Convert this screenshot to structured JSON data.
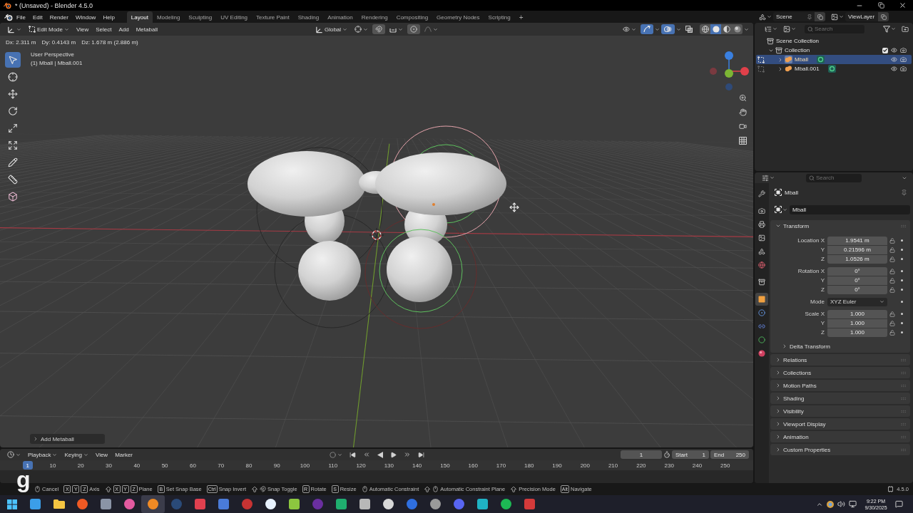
{
  "window": {
    "title": "* (Unsaved) - Blender 4.5.0"
  },
  "menu": [
    "File",
    "Edit",
    "Render",
    "Window",
    "Help"
  ],
  "workspaces": [
    {
      "label": "Layout",
      "selected": true
    },
    {
      "label": "Modeling",
      "selected": false
    },
    {
      "label": "Sculpting",
      "selected": false
    },
    {
      "label": "UV Editing",
      "selected": false
    },
    {
      "label": "Texture Paint",
      "selected": false
    },
    {
      "label": "Shading",
      "selected": false
    },
    {
      "label": "Animation",
      "selected": false
    },
    {
      "label": "Rendering",
      "selected": false
    },
    {
      "label": "Compositing",
      "selected": false
    },
    {
      "label": "Geometry Nodes",
      "selected": false
    },
    {
      "label": "Scripting",
      "selected": false
    }
  ],
  "add_workspace": "+",
  "scene": "Scene",
  "view_layer": "ViewLayer",
  "viewport": {
    "mode": "Edit Mode",
    "menus": [
      "View",
      "Select",
      "Add",
      "Metaball"
    ],
    "orientation": "Global",
    "gizmos": true,
    "overlays": true,
    "xray": false,
    "shading": [
      {
        "kind": "wireframe",
        "selected": false
      },
      {
        "kind": "solid",
        "selected": true
      },
      {
        "kind": "material",
        "selected": false
      },
      {
        "kind": "rendered",
        "selected": false
      }
    ],
    "readout": [
      "Dx: 2.311 m",
      "Dy: 0.4143 m",
      "Dz: 1.678 m (2.886 m)"
    ],
    "view_name": "User Perspective",
    "object_info": "(1) Mball | Mball.001",
    "tools": [
      {
        "kind": "select",
        "selected": true
      },
      {
        "kind": "cursor",
        "selected": false
      },
      {
        "kind": "move",
        "selected": false
      },
      {
        "kind": "rotate",
        "selected": false
      },
      {
        "kind": "scale",
        "selected": false
      },
      {
        "kind": "transform",
        "selected": false
      },
      {
        "kind": "annotate",
        "selected": false
      },
      {
        "kind": "measure",
        "selected": false
      },
      {
        "kind": "add",
        "selected": false
      }
    ],
    "last_operator": {
      "label": "Add Metaball",
      "expanded": false
    }
  },
  "key_overlay": "g",
  "outliner": {
    "search_placeholder": "Search",
    "tree": [
      {
        "kind": "scene_collection",
        "label": "Scene Collection",
        "selected": false,
        "children": [
          {
            "kind": "collection",
            "label": "Collection",
            "selected": false,
            "expanded": true,
            "checked": true,
            "visible": true,
            "renderable": true,
            "children": [
              {
                "kind": "metaball",
                "label": "Mball",
                "selected": true,
                "expanded": false,
                "visible": true,
                "renderable": true
              },
              {
                "kind": "metaball",
                "label": "Mball.001",
                "selected": false,
                "expanded": false,
                "visible": true,
                "renderable": true
              }
            ]
          }
        ]
      }
    ]
  },
  "properties": {
    "search_placeholder": "Search",
    "tabs": [
      {
        "kind": "tool",
        "selected": false
      },
      {
        "kind": "render",
        "selected": false
      },
      {
        "kind": "output",
        "selected": false
      },
      {
        "kind": "view_layer",
        "selected": false
      },
      {
        "kind": "scene",
        "selected": false
      },
      {
        "kind": "world",
        "selected": false
      },
      {
        "kind": "collection",
        "selected": false
      },
      {
        "kind": "object",
        "selected": true
      },
      {
        "kind": "physics",
        "selected": false
      },
      {
        "kind": "constraints",
        "selected": false
      },
      {
        "kind": "data",
        "selected": false
      },
      {
        "kind": "material",
        "selected": false
      }
    ],
    "context": "Mball",
    "name": "Mball",
    "panels": [
      {
        "title": "Transform",
        "expanded": true,
        "groups": [
          [
            {
              "kind": "number",
              "label": "Location X",
              "value": "1.9541 m",
              "locked": false
            },
            {
              "kind": "number",
              "label": "Y",
              "value": "0.21596 m",
              "locked": false
            },
            {
              "kind": "number",
              "label": "Z",
              "value": "1.0526 m",
              "locked": false
            }
          ],
          [
            {
              "kind": "number",
              "label": "Rotation X",
              "value": "0°",
              "locked": false
            },
            {
              "kind": "number",
              "label": "Y",
              "value": "0°",
              "locked": false
            },
            {
              "kind": "number",
              "label": "Z",
              "value": "0°",
              "locked": false
            }
          ],
          [
            {
              "kind": "dropdown",
              "label": "Mode",
              "value": "XYZ Euler"
            }
          ],
          [
            {
              "kind": "number",
              "label": "Scale X",
              "value": "1.000",
              "locked": false
            },
            {
              "kind": "number",
              "label": "Y",
              "value": "1.000",
              "locked": false
            },
            {
              "kind": "number",
              "label": "Z",
              "value": "1.000",
              "locked": false
            }
          ]
        ],
        "subpanels": [
          {
            "title": "Delta Transform",
            "expanded": false
          }
        ]
      },
      {
        "title": "Relations",
        "expanded": false
      },
      {
        "title": "Collections",
        "expanded": false
      },
      {
        "title": "Motion Paths",
        "expanded": false
      },
      {
        "title": "Shading",
        "expanded": false
      },
      {
        "title": "Visibility",
        "expanded": false
      },
      {
        "title": "Viewport Display",
        "expanded": false
      },
      {
        "title": "Animation",
        "expanded": false
      },
      {
        "title": "Custom Properties",
        "expanded": false
      }
    ]
  },
  "timeline": {
    "menus": [
      {
        "label": "Playback",
        "dropdown": true
      },
      {
        "label": "Keying",
        "dropdown": true
      },
      {
        "label": "View",
        "dropdown": false
      },
      {
        "label": "Marker",
        "dropdown": false
      }
    ],
    "frame": "1",
    "start_label": "Start",
    "start": "1",
    "end_label": "End",
    "end": "250",
    "playhead": "1",
    "ruler": [
      "10",
      "20",
      "30",
      "40",
      "50",
      "60",
      "70",
      "80",
      "90",
      "100",
      "110",
      "120",
      "130",
      "140",
      "150",
      "160",
      "170",
      "180",
      "190",
      "200",
      "210",
      "220",
      "230",
      "240",
      "250"
    ]
  },
  "status_bar": {
    "hints": [
      {
        "modifiers": [
          {
            "kind": "mouse"
          }
        ],
        "label": "Cancel"
      },
      {
        "keys": [
          "X",
          "Y",
          "Z"
        ],
        "label": "Axis"
      },
      {
        "modifiers": [
          {
            "kind": "shift"
          }
        ],
        "keys": [
          "X",
          "Y",
          "Z"
        ],
        "label": "Plane"
      },
      {
        "keys": [
          "B"
        ],
        "label": "Set Snap Base"
      },
      {
        "keys": [
          "Ctrl"
        ],
        "label": "Snap Invert"
      },
      {
        "modifiers": [
          {
            "kind": "shift"
          },
          {
            "kind": "snap"
          }
        ],
        "label": "Snap Toggle"
      },
      {
        "keys": [
          "R"
        ],
        "label": "Rotate"
      },
      {
        "keys": [
          "S"
        ],
        "label": "Resize"
      },
      {
        "modifiers": [
          {
            "kind": "mouse"
          }
        ],
        "label": "Automatic Constraint"
      },
      {
        "modifiers": [
          {
            "kind": "shift"
          },
          {
            "kind": "mouse"
          }
        ],
        "label": "Automatic Constraint Plane"
      },
      {
        "modifiers": [
          {
            "kind": "shift"
          }
        ],
        "label": "Precision Mode"
      },
      {
        "keys": [
          "Alt"
        ],
        "label": "Navigate"
      }
    ],
    "version": "4.5.0"
  },
  "taskbar": {
    "apps": [
      {
        "kind": "start",
        "color": "#4cc2ff",
        "selected": false
      },
      {
        "kind": "square",
        "color": "#3b9ee8",
        "selected": false
      },
      {
        "kind": "folder",
        "color": "#f4c542",
        "selected": false
      },
      {
        "kind": "circle",
        "color": "#f05a24",
        "selected": false
      },
      {
        "kind": "square",
        "color": "#8a94a6",
        "selected": false
      },
      {
        "kind": "circle",
        "color": "#e35aa0",
        "selected": false
      },
      {
        "kind": "circle",
        "color": "#f08a24",
        "selected": true
      },
      {
        "kind": "circle",
        "color": "#2a4a78",
        "selected": false
      },
      {
        "kind": "square",
        "color": "#e0404f",
        "selected": false
      },
      {
        "kind": "square",
        "color": "#4a7bd8",
        "selected": false
      },
      {
        "kind": "circle",
        "color": "#c73333",
        "selected": false
      },
      {
        "kind": "circle",
        "color": "#e8f2ff",
        "selected": false
      },
      {
        "kind": "square",
        "color": "#8cc63f",
        "selected": false
      },
      {
        "kind": "circle",
        "color": "#6a2fa0",
        "selected": false
      },
      {
        "kind": "square",
        "color": "#1fae6f",
        "selected": false
      },
      {
        "kind": "square",
        "color": "#b8b8b8",
        "selected": false
      },
      {
        "kind": "circle",
        "color": "#d8d8d8",
        "selected": false
      },
      {
        "kind": "circle",
        "color": "#2f6fe0",
        "selected": false
      },
      {
        "kind": "circle",
        "color": "#9a9a9a",
        "selected": false
      },
      {
        "kind": "circle",
        "color": "#5865f2",
        "selected": false
      },
      {
        "kind": "square",
        "color": "#1fb3c4",
        "selected": false
      },
      {
        "kind": "circle",
        "color": "#1db954",
        "selected": false
      },
      {
        "kind": "square",
        "color": "#d43a3a",
        "selected": false
      }
    ],
    "time": "9:22 PM",
    "date": "9/30/2025"
  }
}
